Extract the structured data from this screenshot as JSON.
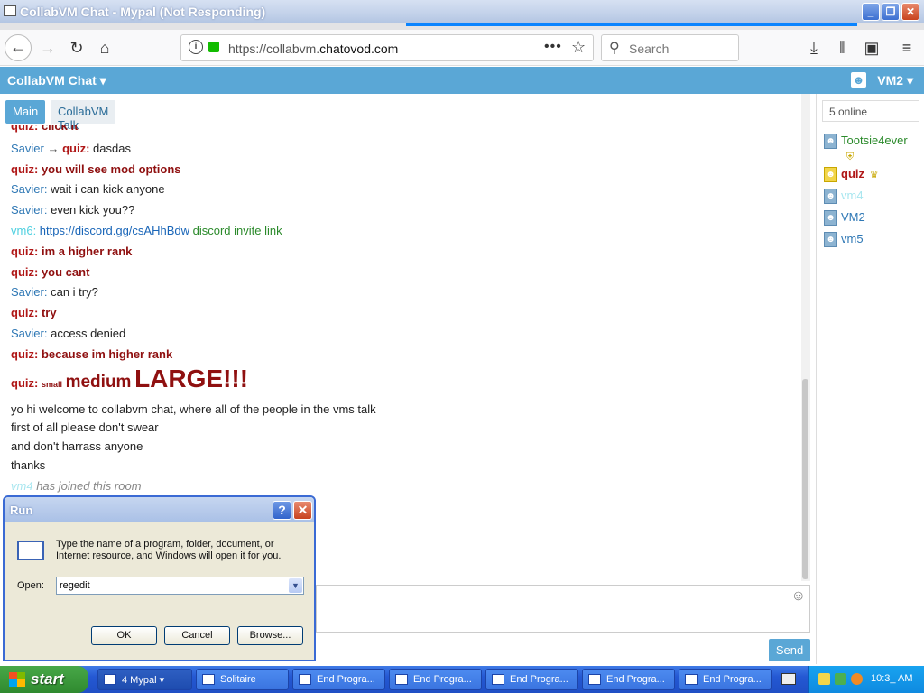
{
  "window": {
    "title": "CollabVM Chat - Mypal (Not Responding)",
    "min": "_",
    "restore": "❐",
    "close": "✕"
  },
  "browser": {
    "url_prefix": "https://collabvm.",
    "url_domain": "chatovod.com",
    "search_placeholder": "Search",
    "more_label": "•••",
    "star_label": "☆"
  },
  "chat": {
    "brand": "CollabVM Chat ▾",
    "current_user": "VM2 ▾",
    "tabs": [
      "Main",
      "CollabVM Talk"
    ],
    "send_label": "Send",
    "messages": [
      {
        "name": "quiz",
        "kind": "quiz",
        "text": "click it"
      },
      {
        "name": "Savier",
        "kind": "pm",
        "to": "quiz",
        "text": "dasdas"
      },
      {
        "name": "quiz",
        "kind": "quiz",
        "text": "you will see mod options"
      },
      {
        "name": "Savier",
        "kind": "savier",
        "text": "wait i can kick anyone"
      },
      {
        "name": "Savier",
        "kind": "savier",
        "text": "even kick you??"
      },
      {
        "name": "vm6",
        "kind": "vm6",
        "link": "https://discord.gg/csAHhBdw",
        "text": "discord invite link"
      },
      {
        "name": "quiz",
        "kind": "quiz",
        "text": "im a higher rank"
      },
      {
        "name": "quiz",
        "kind": "quiz",
        "text": "you cant"
      },
      {
        "name": "Savier",
        "kind": "savier",
        "text": "can i try?"
      },
      {
        "name": "quiz",
        "kind": "quiz",
        "text": "try"
      },
      {
        "name": "Savier",
        "kind": "savier",
        "text": "access denied"
      },
      {
        "name": "quiz",
        "kind": "quiz",
        "text": "because im higher rank"
      },
      {
        "name": "quiz",
        "kind": "sizes",
        "small": "small",
        "medium": "medium",
        "large": "LARGE!!!"
      },
      {
        "kind": "plain",
        "text": "yo hi welcome to collabvm chat, where all of the people in the vms talk"
      },
      {
        "kind": "plain",
        "text": "first of all please don't swear"
      },
      {
        "kind": "plain",
        "text": "and don't harrass anyone"
      },
      {
        "kind": "plain",
        "text": "thanks"
      },
      {
        "name": "vm4",
        "kind": "system",
        "text": "has joined this room"
      }
    ]
  },
  "users": {
    "online_count": "5 online",
    "list": [
      {
        "name": "Tootsie4ever",
        "style": "green",
        "badge": "shield"
      },
      {
        "name": "quiz",
        "style": "red",
        "badge": "crown"
      },
      {
        "name": "vm4",
        "style": "cyan"
      },
      {
        "name": "VM2",
        "style": "blue"
      },
      {
        "name": "vm5",
        "style": "blue"
      }
    ]
  },
  "run_dialog": {
    "title": "Run",
    "help": "?",
    "close": "✕",
    "description": "Type the name of a program, folder, document, or Internet resource, and Windows will open it for you.",
    "open_label": "Open:",
    "value": "regedit",
    "ok": "OK",
    "cancel": "Cancel",
    "browse": "Browse..."
  },
  "taskbar": {
    "start": "start",
    "tasks": [
      {
        "label": "4  Mypal",
        "active": true
      },
      {
        "label": "Solitaire"
      },
      {
        "label": "End Progra..."
      },
      {
        "label": "End Progra..."
      },
      {
        "label": "End Progra..."
      },
      {
        "label": "End Progra..."
      },
      {
        "label": "End Progra..."
      }
    ],
    "clock": "10:3_ AM"
  }
}
